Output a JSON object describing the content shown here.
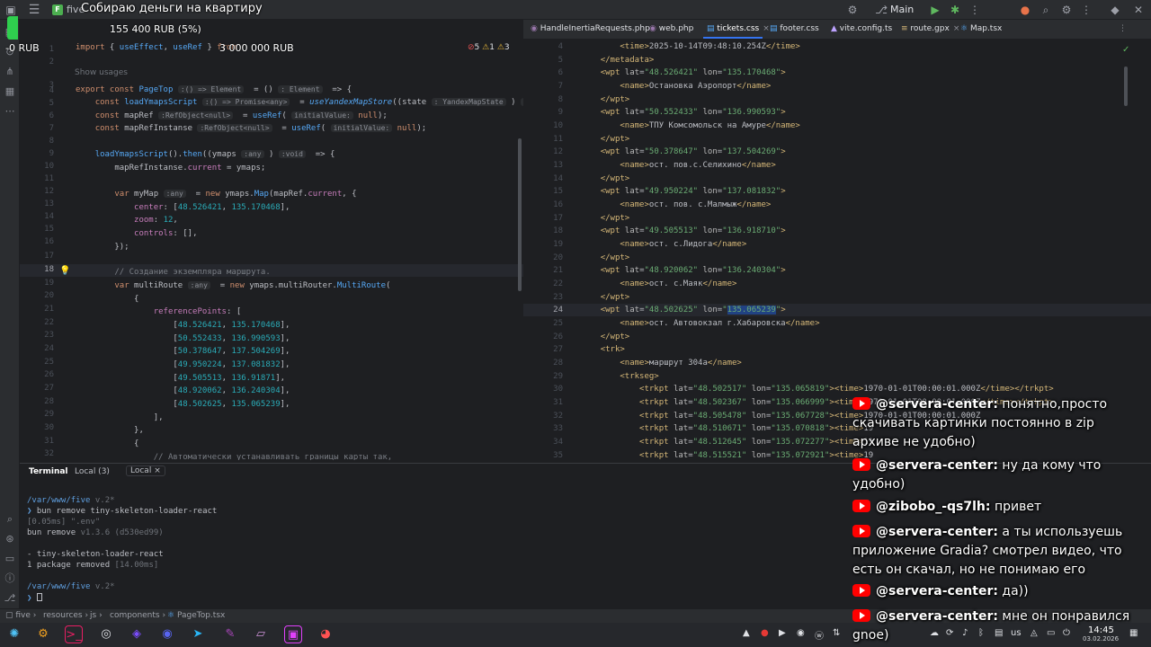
{
  "topbar": {
    "project_badge": "F",
    "project_name": "five",
    "goal_title": "Собираю деньги на квартиру",
    "branch": "Main"
  },
  "goal": {
    "raised_label": "155 400 RUB (5%)",
    "progress_percent": 5,
    "current": "-0 RUB",
    "target": "3 000 000 RUB"
  },
  "left_editor": {
    "warnings": "5",
    "errors": "1",
    "weak": "3",
    "show_usages": "Show usages",
    "lines": [
      "1",
      "2",
      "3",
      "4",
      "5",
      "6",
      "7",
      "8",
      "9",
      "10",
      "11",
      "12",
      "13",
      "14",
      "15",
      "16",
      "17",
      "18",
      "19",
      "20",
      "21",
      "22",
      "23",
      "24",
      "25",
      "26",
      "27",
      "28",
      "29",
      "30",
      "31",
      "32"
    ]
  },
  "right_tabs": [
    {
      "label": "HandleInertiaRequests.php"
    },
    {
      "label": "web.php"
    },
    {
      "label": "tickets.css"
    },
    {
      "label": "footer.css"
    },
    {
      "label": "vite.config.ts"
    },
    {
      "label": "route.gpx"
    },
    {
      "label": "Map.tsx"
    }
  ],
  "right_editor": {
    "lines": [
      "4",
      "5",
      "6",
      "7",
      "8",
      "9",
      "10",
      "11",
      "12",
      "13",
      "14",
      "15",
      "16",
      "17",
      "18",
      "19",
      "20",
      "21",
      "22",
      "23",
      "24",
      "25",
      "26",
      "27",
      "28",
      "29",
      "30",
      "31",
      "32",
      "33",
      "34",
      "35"
    ]
  },
  "terminal": {
    "tabs": [
      "Terminal",
      "Local (3)",
      "Local"
    ],
    "path1": "/var/www/five",
    "version1": "v.2*",
    "cmd": "bun remove tiny-skeleton-loader-react",
    "timing": "[0.05ms] \".env\"",
    "bun_remove": "bun remove",
    "bun_version": "v1.3.6 (d530ed99)",
    "removed_pkg": "- tiny-skeleton-loader-react",
    "removed_summary": "1 package removed",
    "removed_time": "[14.00ms]",
    "path2": "/var/www/five",
    "version2": "v.2*"
  },
  "statusbar": {
    "crumbs": [
      "five",
      "resources",
      "js",
      "components",
      "PageTop.tsx"
    ]
  },
  "taskbar": {
    "lang": "us",
    "time": "14:45",
    "date": "03.02.2026"
  },
  "chat": [
    {
      "author": "@servera-center:",
      "text": "понятно,просто скачивать картинки постоянно в zip архиве не удобно)"
    },
    {
      "author": "@servera-center:",
      "text": "ну да кому что удобно)"
    },
    {
      "author": "@zibobo_-qs7lh:",
      "text": "привет"
    },
    {
      "author": "@servera-center:",
      "text": "а ты используешь приложение Gradia? смотрел видео, что есть он скачал, но не понимаю его"
    },
    {
      "author": "@servera-center:",
      "text": "да))"
    },
    {
      "author": "@servera-center:",
      "text": "мне он понравился gnoe)"
    }
  ],
  "colors": {
    "accent": "#3574f0",
    "goal_green": "#2fcf4e",
    "youtube_red": "#ff0000"
  }
}
